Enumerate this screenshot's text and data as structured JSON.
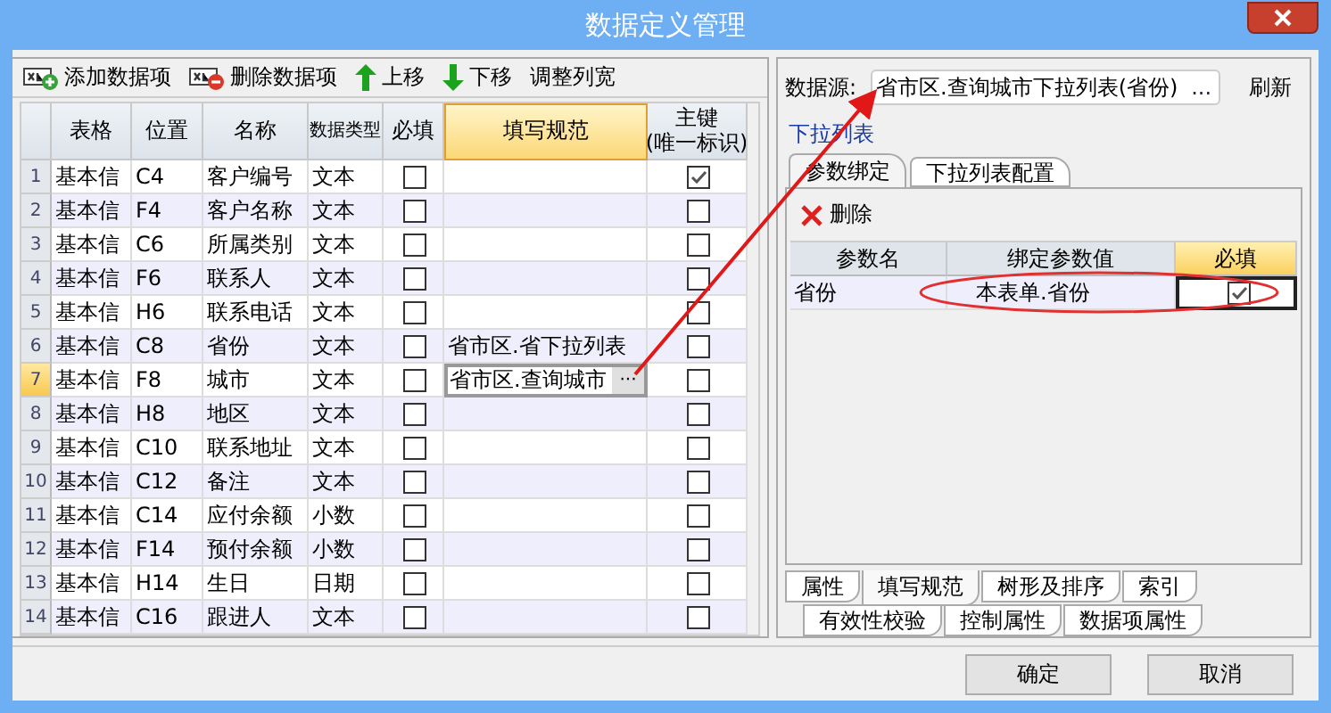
{
  "window": {
    "title": "数据定义管理"
  },
  "toolbar": [
    {
      "kind": "add",
      "label": "添加数据项"
    },
    {
      "kind": "delete",
      "label": "删除数据项"
    },
    {
      "kind": "up",
      "label": "上移"
    },
    {
      "kind": "down",
      "label": "下移"
    },
    {
      "kind": "plain",
      "label": "调整列宽"
    }
  ],
  "grid": {
    "columns": [
      {
        "label": "表格",
        "selected": false
      },
      {
        "label": "位置",
        "selected": false
      },
      {
        "label": "名称",
        "selected": false
      },
      {
        "label": "数据类型",
        "selected": false
      },
      {
        "label": "必填",
        "selected": false
      },
      {
        "label": "填写规范",
        "selected": true
      },
      {
        "label": "主键",
        "sublabel": "(唯一标识)",
        "selected": false
      }
    ],
    "rows": [
      {
        "index": "1",
        "sheet": "基本信",
        "position": "C4",
        "name": "客户编号",
        "type": "文本",
        "required": false,
        "rule": "",
        "primary_key": true,
        "selected": false
      },
      {
        "index": "2",
        "sheet": "基本信",
        "position": "F4",
        "name": "客户名称",
        "type": "文本",
        "required": false,
        "rule": "",
        "primary_key": false,
        "selected": false
      },
      {
        "index": "3",
        "sheet": "基本信",
        "position": "C6",
        "name": "所属类别",
        "type": "文本",
        "required": false,
        "rule": "",
        "primary_key": false,
        "selected": false
      },
      {
        "index": "4",
        "sheet": "基本信",
        "position": "F6",
        "name": "联系人",
        "type": "文本",
        "required": false,
        "rule": "",
        "primary_key": false,
        "selected": false
      },
      {
        "index": "5",
        "sheet": "基本信",
        "position": "H6",
        "name": "联系电话",
        "type": "文本",
        "required": false,
        "rule": "",
        "primary_key": false,
        "selected": false
      },
      {
        "index": "6",
        "sheet": "基本信",
        "position": "C8",
        "name": "省份",
        "type": "文本",
        "required": false,
        "rule": "省市区.省下拉列表",
        "primary_key": false,
        "selected": false
      },
      {
        "index": "7",
        "sheet": "基本信",
        "position": "F8",
        "name": "城市",
        "type": "文本",
        "required": false,
        "rule": "省市区.查询城市",
        "primary_key": false,
        "selected": true,
        "editing": true,
        "edit_button": "···"
      },
      {
        "index": "8",
        "sheet": "基本信",
        "position": "H8",
        "name": "地区",
        "type": "文本",
        "required": false,
        "rule": "",
        "primary_key": false,
        "selected": false
      },
      {
        "index": "9",
        "sheet": "基本信",
        "position": "C10",
        "name": "联系地址",
        "type": "文本",
        "required": false,
        "rule": "",
        "primary_key": false,
        "selected": false
      },
      {
        "index": "10",
        "sheet": "基本信",
        "position": "C12",
        "name": "备注",
        "type": "文本",
        "required": false,
        "rule": "",
        "primary_key": false,
        "selected": false
      },
      {
        "index": "11",
        "sheet": "基本信",
        "position": "C14",
        "name": "应付余额",
        "type": "小数",
        "required": false,
        "rule": "",
        "primary_key": false,
        "selected": false
      },
      {
        "index": "12",
        "sheet": "基本信",
        "position": "F14",
        "name": "预付余额",
        "type": "小数",
        "required": false,
        "rule": "",
        "primary_key": false,
        "selected": false
      },
      {
        "index": "13",
        "sheet": "基本信",
        "position": "H14",
        "name": "生日",
        "type": "日期",
        "required": false,
        "rule": "",
        "primary_key": false,
        "selected": false
      },
      {
        "index": "14",
        "sheet": "基本信",
        "position": "C16",
        "name": "跟进人",
        "type": "文本",
        "required": false,
        "rule": "",
        "primary_key": false,
        "selected": false
      }
    ]
  },
  "data_source": {
    "label": "数据源:",
    "value": "省市区.查询城市下拉列表(省份)",
    "browse_button": "...",
    "refresh_button": "刷新"
  },
  "section_link": "下拉列表",
  "inner_tabs": [
    {
      "label": "参数绑定",
      "selected": true
    },
    {
      "label": "下拉列表配置",
      "selected": false
    }
  ],
  "delete_button": "删除",
  "param_grid": {
    "columns": [
      {
        "label": "参数名",
        "selected": false
      },
      {
        "label": "绑定参数值",
        "selected": false
      },
      {
        "label": "必填",
        "selected": true
      }
    ],
    "rows": [
      {
        "name": "省份",
        "value": "本表单.省份",
        "required": true
      }
    ]
  },
  "bottom_tabs": [
    [
      {
        "label": "属性",
        "selected": false
      },
      {
        "label": "填写规范",
        "selected": true
      },
      {
        "label": "树形及排序",
        "selected": false
      },
      {
        "label": "索引",
        "selected": false
      }
    ],
    [
      {
        "label": "有效性校验",
        "selected": false
      },
      {
        "label": "控制属性",
        "selected": false
      },
      {
        "label": "数据项属性",
        "selected": false
      }
    ]
  ],
  "buttons": [
    "确定",
    "取消"
  ]
}
